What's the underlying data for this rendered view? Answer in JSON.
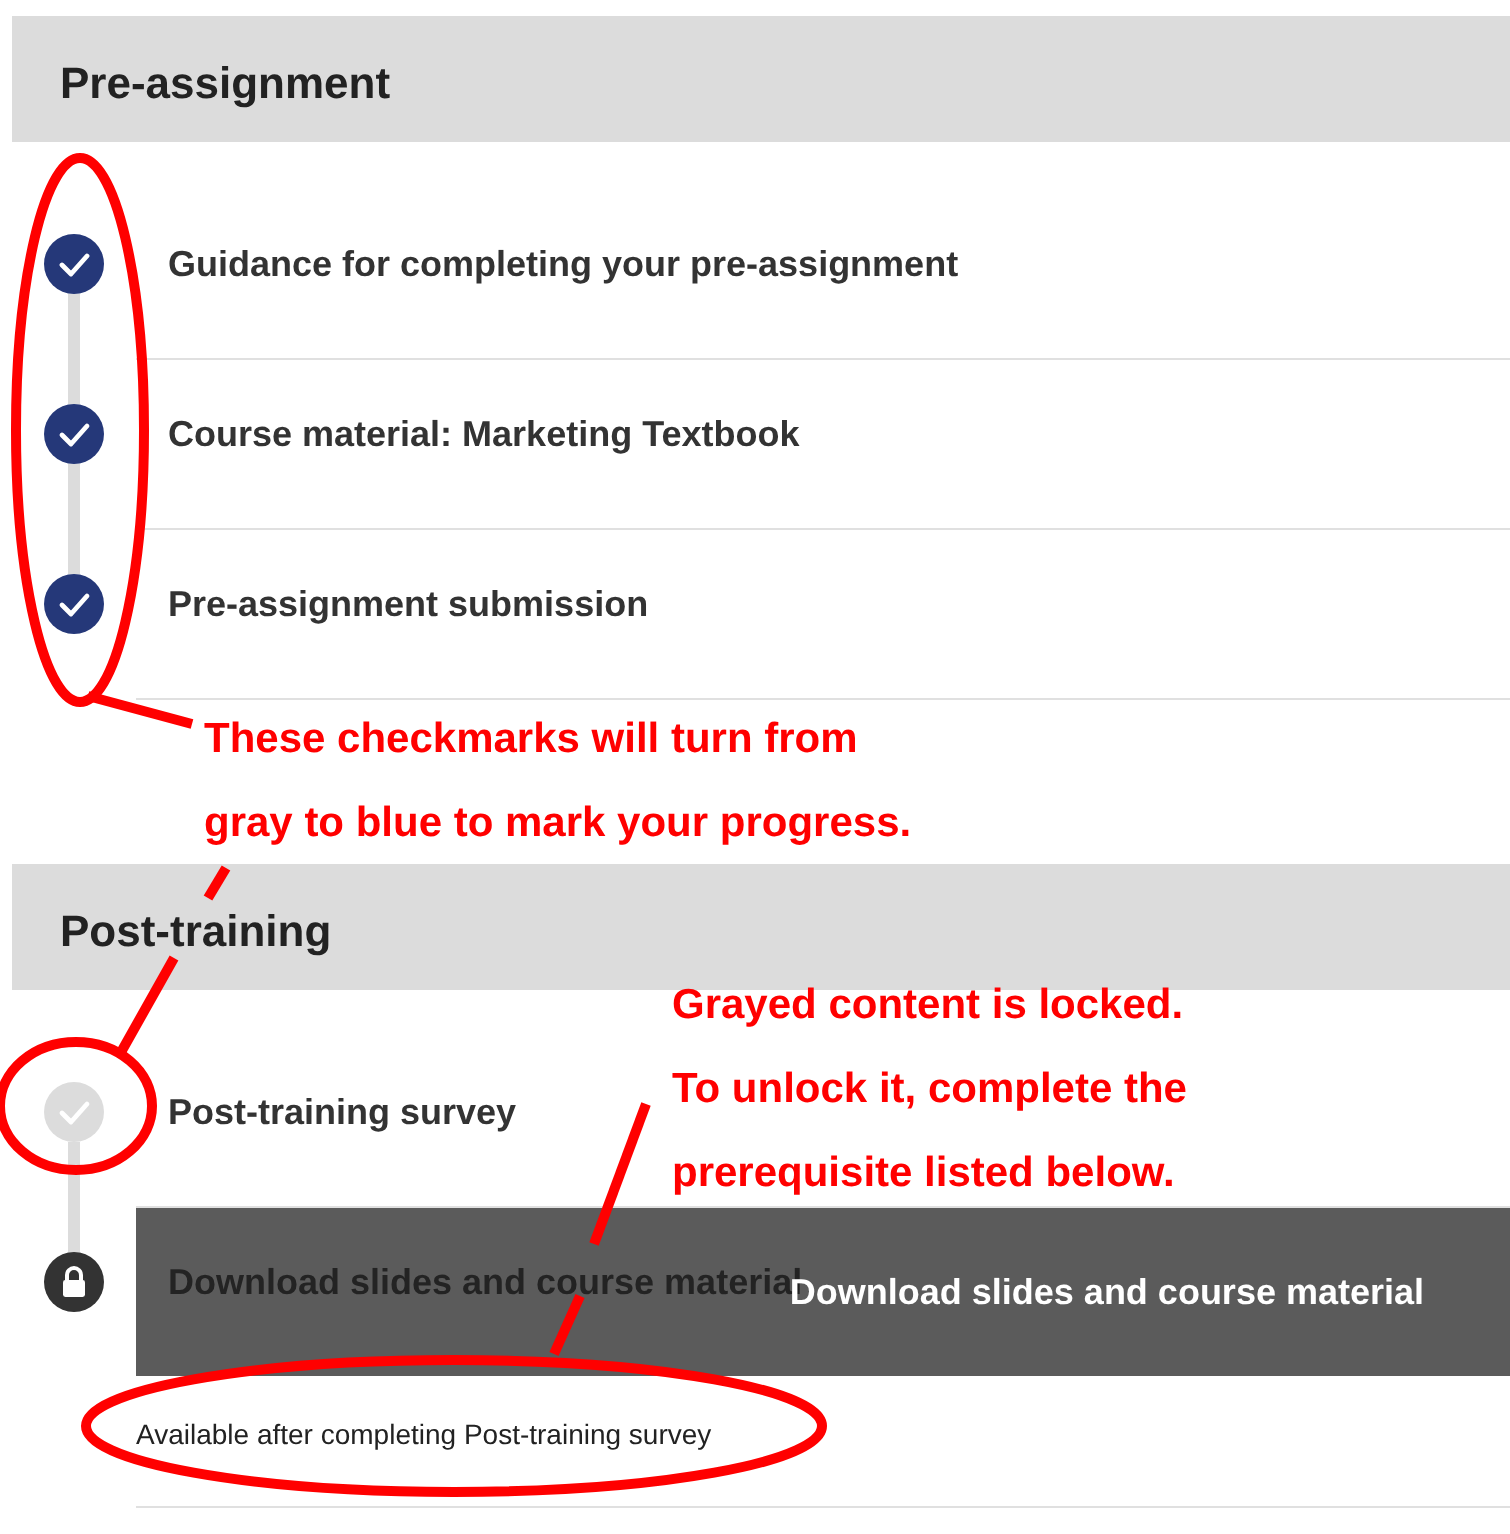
{
  "sections": [
    {
      "title": "Pre-assignment",
      "items": [
        {
          "label": "Guidance for completing your pre-assignment",
          "checked": true
        },
        {
          "label": "Course material: Marketing Textbook",
          "checked": true
        },
        {
          "label": "Pre-assignment submission",
          "checked": true
        }
      ]
    },
    {
      "title": "Post-training",
      "items": [
        {
          "label": "Post-training survey",
          "checked": false
        },
        {
          "label": "Download slides and course material",
          "locked": true,
          "note": "Available after completing Post-training survey",
          "tooltip": "Download slides and course material"
        }
      ]
    }
  ],
  "annotations": [
    {
      "lines": [
        "These checkmarks will turn from",
        "gray to blue to mark your progress."
      ]
    },
    {
      "lines": [
        "Grayed content is locked.",
        "To unlock it, complete the",
        "prerequisite listed below."
      ]
    }
  ]
}
